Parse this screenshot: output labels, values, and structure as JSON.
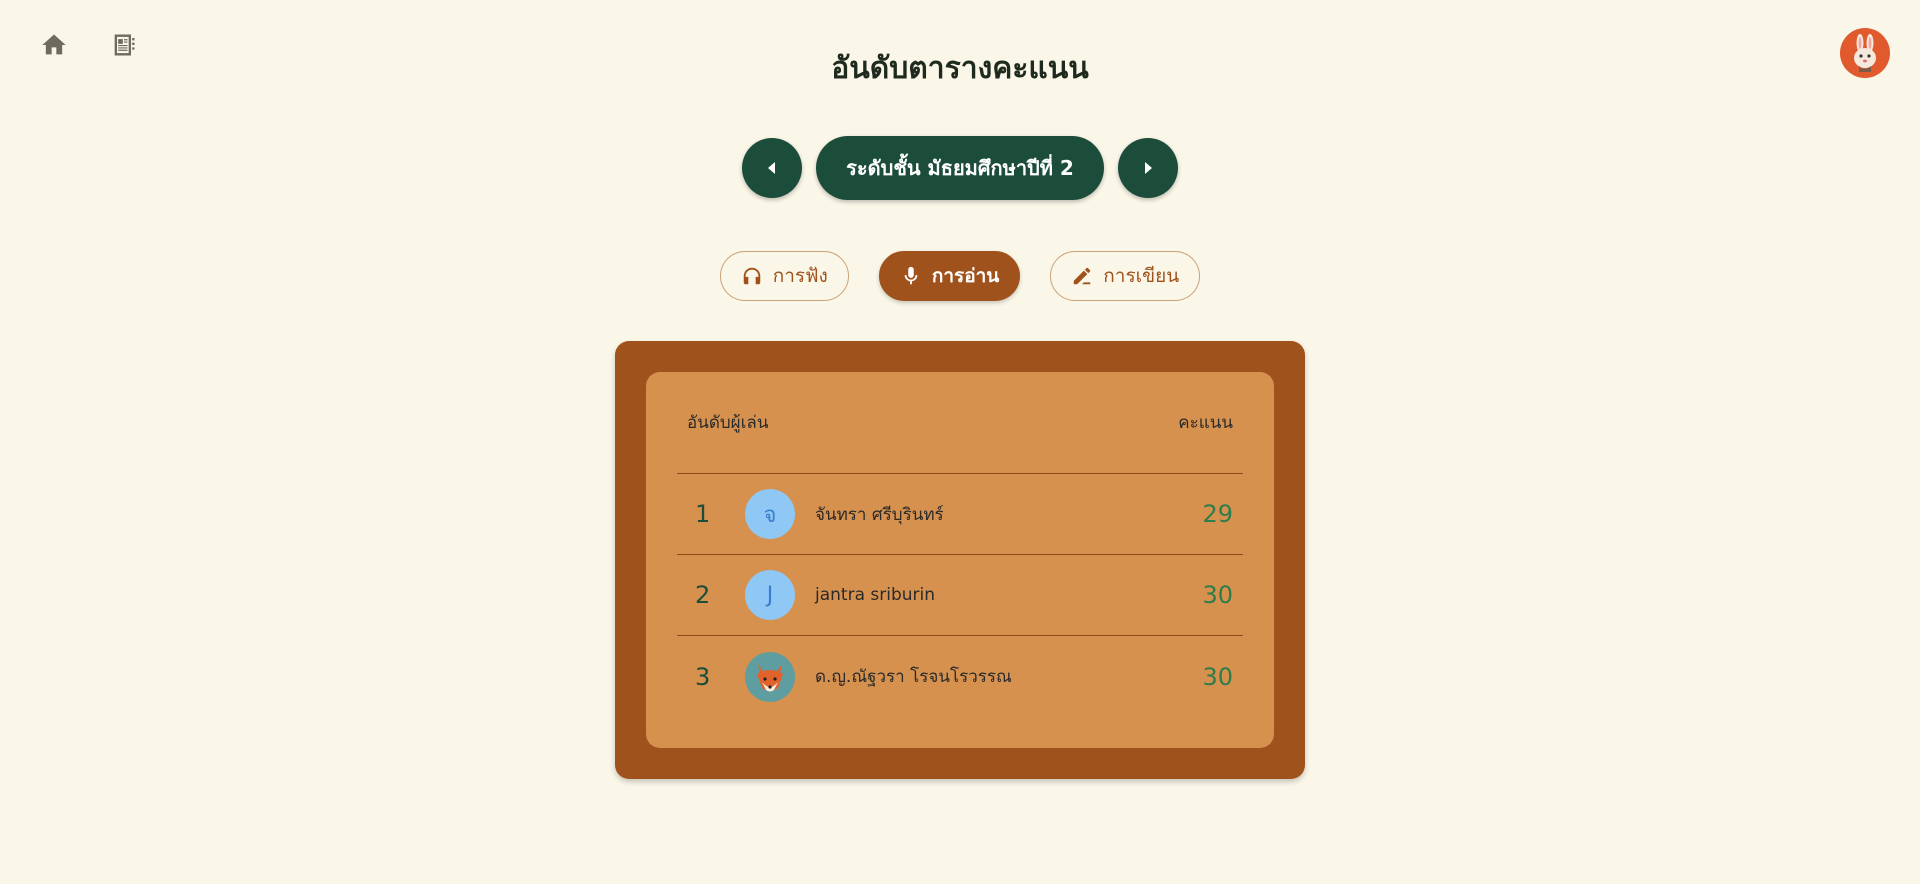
{
  "header": {
    "title": "อันดับตารางคะแนน",
    "home_icon": "home-icon",
    "news_icon": "newspaper-icon",
    "profile_avatar": "rabbit-avatar"
  },
  "level": {
    "label": "ระดับชั้น มัธยมศึกษาปีที่ 2",
    "prev_icon": "caret-left-icon",
    "next_icon": "caret-right-icon"
  },
  "tabs": [
    {
      "label": "การฟัง",
      "icon": "headphones-icon",
      "active": false
    },
    {
      "label": "การอ่าน",
      "icon": "microphone-icon",
      "active": true
    },
    {
      "label": "การเขียน",
      "icon": "pen-icon",
      "active": false
    }
  ],
  "leaderboard": {
    "col_rank_player": "อันดับผู้เล่น",
    "col_score": "คะแนน",
    "rows": [
      {
        "rank": "1",
        "avatar": "จ",
        "name": "จันทรา ศรีบุรินทร์",
        "score": "29"
      },
      {
        "rank": "2",
        "avatar": "J",
        "name": "jantra sriburin",
        "score": "30"
      },
      {
        "rank": "3",
        "avatar": "fox-avatar",
        "name": "ด.ญ.ณัฐวรา โรจนโรวรรณ",
        "score": "30"
      }
    ]
  },
  "colors": {
    "background": "#faf6e8",
    "dark_green": "#1b4d3a",
    "brown": "#a0521c",
    "orange_panel": "#d6914e",
    "score_green": "#2e7d4a"
  }
}
